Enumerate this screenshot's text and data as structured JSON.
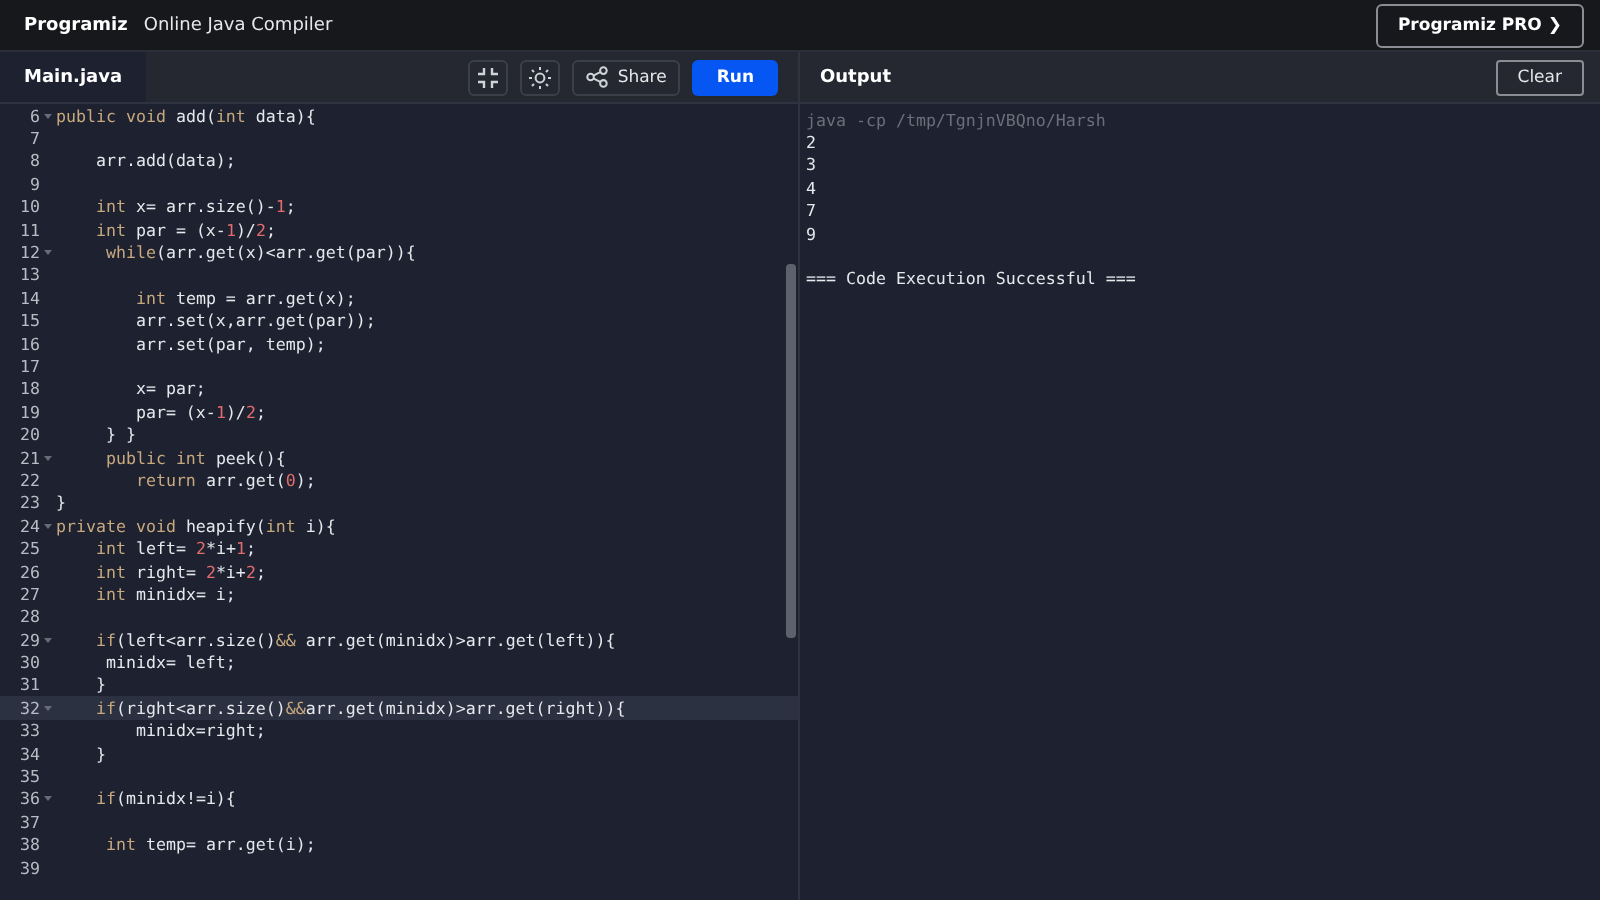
{
  "header": {
    "logo": "Programiz",
    "title": "Online Java Compiler",
    "pro_button": "Programiz PRO ❯"
  },
  "editor": {
    "tab": {
      "label": "Main.java",
      "selected": true
    },
    "share_button": "Share",
    "run_button": "Run",
    "lines": [
      {
        "n": "6",
        "fold": true,
        "active": false,
        "seg": [
          {
            "kind": "kw",
            "t": "public void "
          },
          {
            "kind": "id",
            "t": "add("
          },
          {
            "kind": "kw",
            "t": "int "
          },
          {
            "kind": "id",
            "t": "data){"
          }
        ]
      },
      {
        "n": "7",
        "fold": false,
        "active": false
      },
      {
        "n": "8",
        "fold": false,
        "active": false,
        "seg": [
          {
            "kind": "id",
            "t": "    arr.add(data);"
          }
        ]
      },
      {
        "n": "9",
        "fold": false,
        "active": false
      },
      {
        "n": "10",
        "fold": false,
        "active": false,
        "seg": [
          {
            "kind": "kw",
            "t": "    int "
          },
          {
            "kind": "id",
            "t": "x= arr.size()-"
          },
          {
            "kind": "num",
            "t": "1"
          },
          {
            "kind": "id",
            "t": ";"
          }
        ]
      },
      {
        "n": "11",
        "fold": false,
        "active": false,
        "seg": [
          {
            "kind": "kw",
            "t": "    int "
          },
          {
            "kind": "id",
            "t": "par = (x-"
          },
          {
            "kind": "num",
            "t": "1"
          },
          {
            "kind": "id",
            "t": ")/"
          },
          {
            "kind": "num",
            "t": "2"
          },
          {
            "kind": "id",
            "t": ";"
          }
        ]
      },
      {
        "n": "12",
        "fold": true,
        "active": false,
        "seg": [
          {
            "kind": "kw",
            "t": "     while"
          },
          {
            "kind": "id",
            "t": "(arr.get(x)<arr.get(par)){"
          }
        ]
      },
      {
        "n": "13",
        "fold": false,
        "active": false
      },
      {
        "n": "14",
        "fold": false,
        "active": false,
        "seg": [
          {
            "kind": "kw",
            "t": "        int "
          },
          {
            "kind": "id",
            "t": "temp = arr.get(x);"
          }
        ]
      },
      {
        "n": "15",
        "fold": false,
        "active": false,
        "seg": [
          {
            "kind": "id",
            "t": "        arr.set(x,arr.get(par));"
          }
        ]
      },
      {
        "n": "16",
        "fold": false,
        "active": false,
        "seg": [
          {
            "kind": "id",
            "t": "        arr.set(par, temp);"
          }
        ]
      },
      {
        "n": "17",
        "fold": false,
        "active": false
      },
      {
        "n": "18",
        "fold": false,
        "active": false,
        "seg": [
          {
            "kind": "id",
            "t": "        x= par;"
          }
        ]
      },
      {
        "n": "19",
        "fold": false,
        "active": false,
        "seg": [
          {
            "kind": "id",
            "t": "        par= (x-"
          },
          {
            "kind": "num",
            "t": "1"
          },
          {
            "kind": "id",
            "t": ")/"
          },
          {
            "kind": "num",
            "t": "2"
          },
          {
            "kind": "id",
            "t": ";"
          }
        ]
      },
      {
        "n": "20",
        "fold": false,
        "active": false,
        "seg": [
          {
            "kind": "id",
            "t": "     } }"
          }
        ]
      },
      {
        "n": "21",
        "fold": true,
        "active": false,
        "seg": [
          {
            "kind": "kw",
            "t": "     public int "
          },
          {
            "kind": "id",
            "t": "peek(){"
          }
        ]
      },
      {
        "n": "22",
        "fold": false,
        "active": false,
        "seg": [
          {
            "kind": "kw",
            "t": "        return "
          },
          {
            "kind": "id",
            "t": "arr.get("
          },
          {
            "kind": "num",
            "t": "0"
          },
          {
            "kind": "id",
            "t": ");"
          }
        ]
      },
      {
        "n": "23",
        "fold": false,
        "active": false,
        "seg": [
          {
            "kind": "id",
            "t": "}"
          }
        ]
      },
      {
        "n": "24",
        "fold": true,
        "active": false,
        "seg": [
          {
            "kind": "kw",
            "t": "private void "
          },
          {
            "kind": "id",
            "t": "heapify("
          },
          {
            "kind": "kw",
            "t": "int "
          },
          {
            "kind": "id",
            "t": "i){"
          }
        ]
      },
      {
        "n": "25",
        "fold": false,
        "active": false,
        "seg": [
          {
            "kind": "kw",
            "t": "    int "
          },
          {
            "kind": "id",
            "t": "left= "
          },
          {
            "kind": "num",
            "t": "2"
          },
          {
            "kind": "id",
            "t": "*i+"
          },
          {
            "kind": "num",
            "t": "1"
          },
          {
            "kind": "id",
            "t": ";"
          }
        ]
      },
      {
        "n": "26",
        "fold": false,
        "active": false,
        "seg": [
          {
            "kind": "kw",
            "t": "    int "
          },
          {
            "kind": "id",
            "t": "right= "
          },
          {
            "kind": "num",
            "t": "2"
          },
          {
            "kind": "id",
            "t": "*i+"
          },
          {
            "kind": "num",
            "t": "2"
          },
          {
            "kind": "id",
            "t": ";"
          }
        ]
      },
      {
        "n": "27",
        "fold": false,
        "active": false,
        "seg": [
          {
            "kind": "kw",
            "t": "    int "
          },
          {
            "kind": "id",
            "t": "minidx= i;"
          }
        ]
      },
      {
        "n": "28",
        "fold": false,
        "active": false
      },
      {
        "n": "29",
        "fold": true,
        "active": false,
        "seg": [
          {
            "kind": "kw",
            "t": "    if"
          },
          {
            "kind": "id",
            "t": "(left<arr.size()"
          },
          {
            "kind": "kw",
            "t": "&&"
          },
          {
            "kind": "id",
            "t": " arr.get(minidx)>arr.get(left)){"
          }
        ]
      },
      {
        "n": "30",
        "fold": false,
        "active": false,
        "seg": [
          {
            "kind": "id",
            "t": "     minidx= left;"
          }
        ]
      },
      {
        "n": "31",
        "fold": false,
        "active": false,
        "seg": [
          {
            "kind": "id",
            "t": "    }"
          }
        ]
      },
      {
        "n": "32",
        "fold": true,
        "active": true,
        "seg": [
          {
            "kind": "kw",
            "t": "    if"
          },
          {
            "kind": "id",
            "t": "(right<arr.size()"
          },
          {
            "kind": "kw",
            "t": "&&"
          },
          {
            "kind": "id",
            "t": "arr.get(minidx)>arr.get(right)){"
          }
        ]
      },
      {
        "n": "33",
        "fold": false,
        "active": false,
        "seg": [
          {
            "kind": "id",
            "t": "        minidx=right;"
          }
        ]
      },
      {
        "n": "34",
        "fold": false,
        "active": false,
        "seg": [
          {
            "kind": "id",
            "t": "    }"
          }
        ]
      },
      {
        "n": "35",
        "fold": false,
        "active": false
      },
      {
        "n": "36",
        "fold": true,
        "active": false,
        "seg": [
          {
            "kind": "kw",
            "t": "    if"
          },
          {
            "kind": "id",
            "t": "(minidx!=i){"
          }
        ]
      },
      {
        "n": "37",
        "fold": false,
        "active": false
      },
      {
        "n": "38",
        "fold": false,
        "active": false,
        "seg": [
          {
            "kind": "kw",
            "t": "     int "
          },
          {
            "kind": "id",
            "t": "temp= arr.get(i);"
          }
        ]
      },
      {
        "n": "39",
        "fold": false,
        "active": false
      }
    ]
  },
  "output": {
    "title": "Output",
    "clear_button": "Clear",
    "lines": [
      {
        "kind": "command",
        "text": "java -cp /tmp/TgnjnVBQno/Harsh"
      },
      {
        "kind": "out",
        "text": "2"
      },
      {
        "kind": "out",
        "text": "3"
      },
      {
        "kind": "out",
        "text": "4"
      },
      {
        "kind": "out",
        "text": "7"
      },
      {
        "kind": "out",
        "text": "9"
      },
      {
        "kind": "blank"
      },
      {
        "kind": "out",
        "text": "=== Code Execution Successful ==="
      }
    ]
  }
}
